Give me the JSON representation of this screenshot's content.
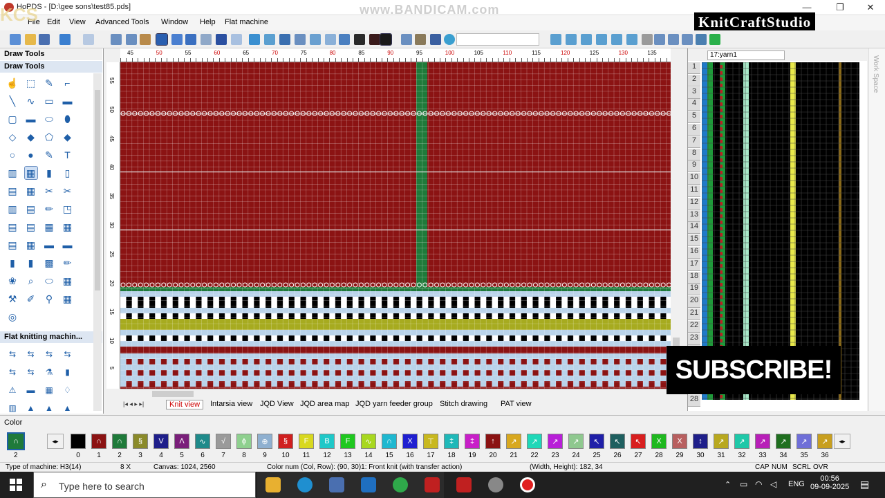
{
  "window": {
    "title": "HoPDS - [D:\\gee sons\\test85.pds]",
    "min": "—",
    "max": "❐",
    "close": "✕"
  },
  "watermark": "www.BANDICAM.com",
  "overlay": {
    "kcs": "KCS",
    "brand": "KnitCraftStudio",
    "subscribe": "SUBSCRIBE!"
  },
  "menu": [
    "File",
    "Edit",
    "View",
    "Advanced Tools",
    "Window",
    "Help",
    "Flat machine"
  ],
  "left_panel": {
    "title": "Draw Tools",
    "section1": "Draw Tools",
    "section2": "Flat knitting machin..."
  },
  "ruler_top": [
    "45",
    "50",
    "55",
    "60",
    "65",
    "70",
    "75",
    "80",
    "85",
    "90",
    "95",
    "100",
    "105",
    "110",
    "115",
    "120",
    "125",
    "130",
    "135"
  ],
  "ruler_left": [
    "55",
    "50",
    "45",
    "40",
    "35",
    "30",
    "25",
    "20",
    "15",
    "10",
    "5"
  ],
  "tabs": [
    "Knit view",
    "Intarsia view",
    "JQD View",
    "JQD area map",
    "JQD yarn feeder group",
    "Stitch drawing",
    "PAT view"
  ],
  "active_tab": "Knit view",
  "right_panel": {
    "yarn_combo": "17:yarn1",
    "workspace": "Work Space",
    "rows": [
      "1",
      "2",
      "3",
      "4",
      "5",
      "6",
      "7",
      "8",
      "9",
      "10",
      "11",
      "12",
      "13",
      "14",
      "15",
      "16",
      "17",
      "18",
      "19",
      "20",
      "21",
      "22",
      "23",
      "24",
      "25",
      "26",
      "27",
      "28"
    ]
  },
  "color_panel": {
    "title": "Color",
    "current": "2",
    "swatches": [
      {
        "n": "0",
        "c": "#000000",
        "g": ""
      },
      {
        "n": "1",
        "c": "#8b1313",
        "g": "∩"
      },
      {
        "n": "2",
        "c": "#1f7a3a",
        "g": "∩"
      },
      {
        "n": "3",
        "c": "#8a8a2a",
        "g": "§"
      },
      {
        "n": "4",
        "c": "#1f1f8a",
        "g": "V"
      },
      {
        "n": "5",
        "c": "#7a1f7a",
        "g": "Λ"
      },
      {
        "n": "6",
        "c": "#1f8a8a",
        "g": "∿"
      },
      {
        "n": "7",
        "c": "#9a9a9a",
        "g": "√"
      },
      {
        "n": "8",
        "c": "#8fd08f",
        "g": "ϕ"
      },
      {
        "n": "9",
        "c": "#8fb0d0",
        "g": "⊕"
      },
      {
        "n": "10",
        "c": "#d01f1f",
        "g": "§"
      },
      {
        "n": "11",
        "c": "#d8d81f",
        "g": "F"
      },
      {
        "n": "12",
        "c": "#1fc8c8",
        "g": "B"
      },
      {
        "n": "13",
        "c": "#1fc81f",
        "g": "F"
      },
      {
        "n": "14",
        "c": "#a8d81f",
        "g": "∿"
      },
      {
        "n": "15",
        "c": "#1fb8d0",
        "g": "∩"
      },
      {
        "n": "16",
        "c": "#1f1fd0",
        "g": "X"
      },
      {
        "n": "17",
        "c": "#c8b81f",
        "g": "⊤"
      },
      {
        "n": "18",
        "c": "#1fb8b8",
        "g": "‡"
      },
      {
        "n": "19",
        "c": "#c81fc8",
        "g": "‡"
      },
      {
        "n": "20",
        "c": "#8b1313",
        "g": "↑"
      },
      {
        "n": "21",
        "c": "#d8a81f",
        "g": "↗"
      },
      {
        "n": "22",
        "c": "#1fd8b8",
        "g": "↗"
      },
      {
        "n": "23",
        "c": "#b81fd8",
        "g": "↗"
      },
      {
        "n": "24",
        "c": "#8fc88f",
        "g": "↗"
      },
      {
        "n": "25",
        "c": "#1f1fa8",
        "g": "↖"
      },
      {
        "n": "26",
        "c": "#1f5f5f",
        "g": "↖"
      },
      {
        "n": "27",
        "c": "#d81f1f",
        "g": "↖"
      },
      {
        "n": "28",
        "c": "#1fb81f",
        "g": "X"
      },
      {
        "n": "29",
        "c": "#b85f5f",
        "g": "X"
      },
      {
        "n": "30",
        "c": "#1f1f8a",
        "g": "↕"
      },
      {
        "n": "31",
        "c": "#b8a81f",
        "g": "↗"
      },
      {
        "n": "32",
        "c": "#1fc8a8",
        "g": "↗"
      },
      {
        "n": "33",
        "c": "#b81fb8",
        "g": "↗"
      },
      {
        "n": "34",
        "c": "#1f6f1f",
        "g": "↗"
      },
      {
        "n": "35",
        "c": "#6f6fd8",
        "g": "↗"
      },
      {
        "n": "36",
        "c": "#c89f1f",
        "g": "↗"
      }
    ]
  },
  "status": {
    "machine": "Type of machine: H3(14)",
    "gauge": "8 X",
    "canvas": "Canvas: 1024, 2560",
    "colornum": "Color num  (Col, Row): (90, 30)1: Front knit (with transfer action)",
    "size": "(Width, Height): 182, 34",
    "cap": "CAP",
    "num": "NUM",
    "scrl": "SCRL",
    "ovr": "OVR"
  },
  "taskbar": {
    "search": "Type here to search",
    "lang": "ENG",
    "time": "00:56",
    "date": "09-09-2025"
  },
  "colors": {
    "maroon": "#8b1313",
    "green": "#1f7a3a",
    "lightblue": "#b9d3ea",
    "olive": "#a7ab1f"
  }
}
